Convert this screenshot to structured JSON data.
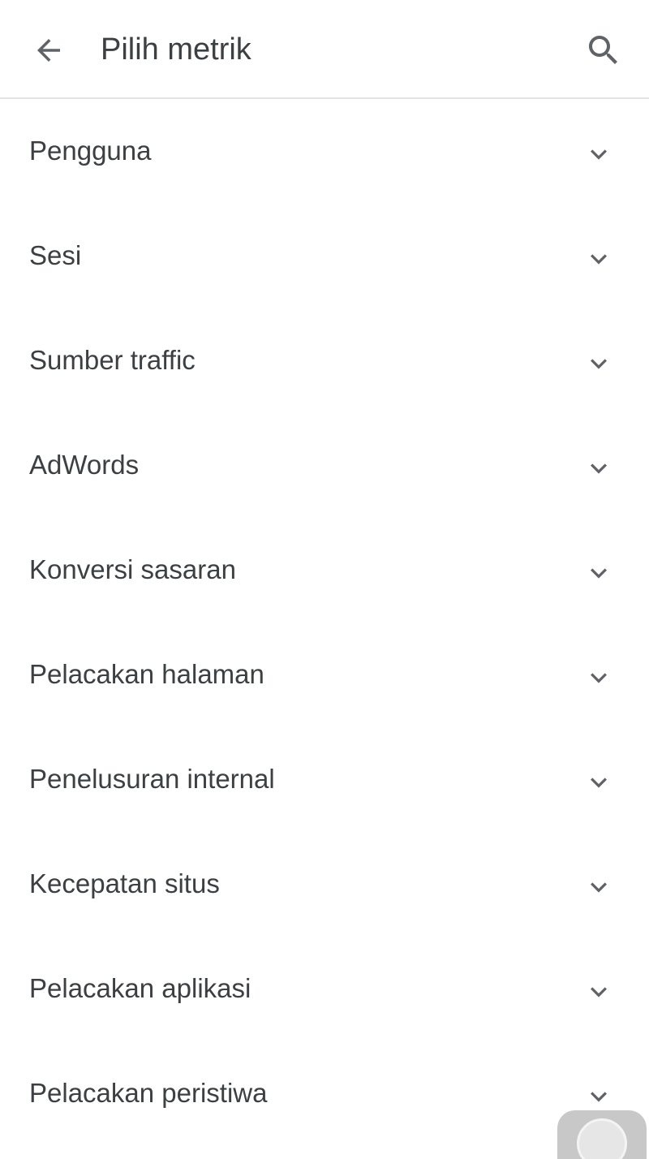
{
  "header": {
    "title": "Pilih metrik",
    "back_icon": "arrow-back-icon",
    "search_icon": "search-icon"
  },
  "metric_categories": [
    {
      "label": "Pengguna"
    },
    {
      "label": "Sesi"
    },
    {
      "label": "Sumber traffic"
    },
    {
      "label": "AdWords"
    },
    {
      "label": "Konversi sasaran"
    },
    {
      "label": "Pelacakan halaman"
    },
    {
      "label": "Penelusuran internal"
    },
    {
      "label": "Kecepatan situs"
    },
    {
      "label": "Pelacakan aplikasi"
    },
    {
      "label": "Pelacakan peristiwa"
    }
  ],
  "colors": {
    "text": "#3c4043",
    "icon": "#5f6368",
    "divider": "#e3e3e3",
    "background": "#ffffff"
  }
}
